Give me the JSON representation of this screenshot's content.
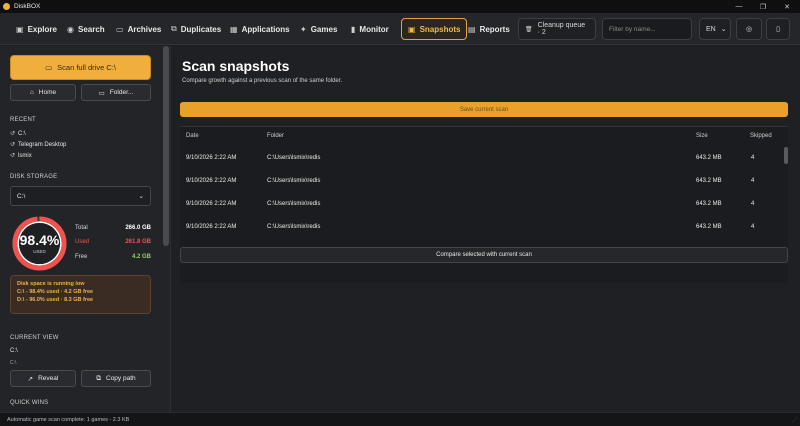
{
  "window": {
    "title": "DiskBOX",
    "minimize_glyph": "—",
    "maximize_glyph": "❐",
    "close_glyph": "✕"
  },
  "toolbar": {
    "nav": [
      {
        "label": "Explore",
        "icon": "▣"
      },
      {
        "label": "Search",
        "icon": "◉"
      },
      {
        "label": "Archives",
        "icon": "▭"
      },
      {
        "label": "Duplicates",
        "icon": "⧉"
      },
      {
        "label": "Applications",
        "icon": "▦"
      },
      {
        "label": "Games",
        "icon": "✦"
      },
      {
        "label": "Monitor",
        "icon": "▮"
      },
      {
        "label": "Snapshots",
        "icon": "▣"
      },
      {
        "label": "Reports",
        "icon": "▤"
      }
    ],
    "active_nav": "Snapshots",
    "cleanup_queue_label": "Cleanup queue · 2",
    "cleanup_icon": "🗑",
    "filter_placeholder": "Filter by name...",
    "language": "EN",
    "language_chevron": "⌄",
    "theme_icon": "◎",
    "panel_icon": "▯"
  },
  "sidebar": {
    "scan_button_label": "Scan full drive  C:\\",
    "scan_icon": "▭",
    "home_label": "Home",
    "home_icon": "⌂",
    "folder_label": "Folder...",
    "folder_icon": "▭",
    "recent_title": "RECENT",
    "recent_items": [
      "C:\\",
      "Telegram Desktop",
      "lsmix"
    ],
    "recent_icon": "↺",
    "disk_storage_title": "DISK STORAGE",
    "selected_drive": "C:\\",
    "drive_chevron": "⌄",
    "gauge_percent": "98.4%",
    "gauge_percent_value": 98.4,
    "gauge_label": "USED",
    "stats": [
      {
        "label": "Total",
        "value": "266.0 GB",
        "color": "#ffffff"
      },
      {
        "label": "Used",
        "value": "261.8 GB",
        "color": "#ef5350"
      },
      {
        "label": "Free",
        "value": "4.2 GB",
        "color": "#8fd16a"
      }
    ],
    "warning": {
      "title": "Disk space is running low",
      "lines": [
        "C:\\ - 98.4% used · 4.2 GB free",
        "D:\\ - 96.0% used · 8.3 GB free"
      ]
    },
    "current_view_title": "CURRENT VIEW",
    "current_path": "C:\\",
    "current_path_sub": "C:\\",
    "reveal_label": "Reveal",
    "reveal_icon": "↗",
    "copy_path_label": "Copy path",
    "copy_icon": "⧉",
    "quick_wins_title": "QUICK WINS"
  },
  "main": {
    "title": "Scan snapshots",
    "subtitle": "Compare growth against a previous scan of the same folder.",
    "save_button_label": "Save current scan",
    "columns": {
      "date": "Date",
      "folder": "Folder",
      "size": "Size",
      "skipped": "Skipped"
    },
    "rows": [
      {
        "date": "9/10/2026 2:22 AM",
        "folder": "C:\\Users\\lsmix\\redis",
        "size": "643.2 MB",
        "skipped": "4"
      },
      {
        "date": "9/10/2026 2:22 AM",
        "folder": "C:\\Users\\lsmix\\redis",
        "size": "643.2 MB",
        "skipped": "4"
      },
      {
        "date": "9/10/2026 2:22 AM",
        "folder": "C:\\Users\\lsmix\\redis",
        "size": "643.2 MB",
        "skipped": "4"
      },
      {
        "date": "9/10/2026 2:22 AM",
        "folder": "C:\\Users\\lsmix\\redis",
        "size": "643.2 MB",
        "skipped": "4"
      }
    ],
    "compare_button_label": "Compare selected with current scan"
  },
  "status": {
    "text": "Automatic game scan complete: 1 games - 2.3 KB"
  },
  "colors": {
    "accent": "#f0ae3c",
    "gauge_ring": "#ef5350",
    "warning_text": "#f0b34a"
  }
}
